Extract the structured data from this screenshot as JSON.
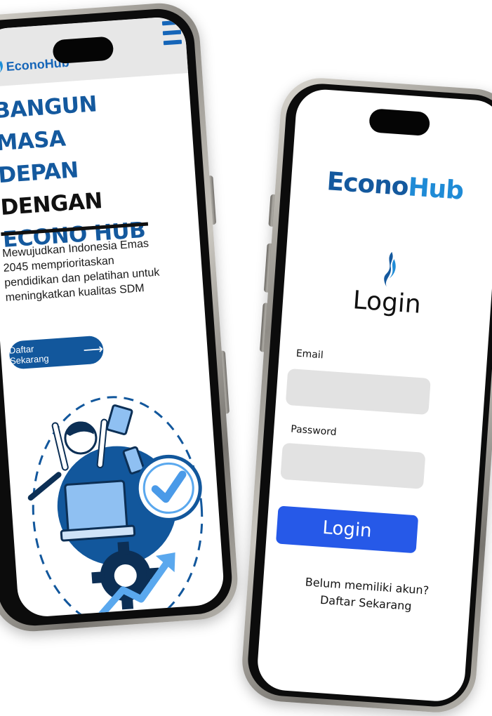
{
  "landing": {
    "logo_text": "EconoHub",
    "hero_line1": "BANGUN MASA",
    "hero_line2": "DEPAN",
    "hero_line3": "DENGAN",
    "hero_line4": "ECONO HUB",
    "description": "Mewujudkan Indonesia Emas 2045 memprioritaskan pendidikan dan pelatihan untuk meningkatkan kualitas SDM",
    "cta_label": "Daftar Sekarang"
  },
  "login": {
    "logo_part1": "Econo",
    "logo_part2": "Hub",
    "title": "Login",
    "email_label": "Email",
    "password_label": "Password",
    "button_label": "Login",
    "signup_prompt": "Belum memiliki akun?",
    "signup_link": "Daftar Sekarang"
  },
  "colors": {
    "primary": "#14599e",
    "accent": "#1f8bd6",
    "button": "#2659e8",
    "field": "#e2e2e2"
  },
  "icons": [
    "econohub-flame-icon",
    "menu-icon",
    "arrow-right-icon",
    "checkmark-icon",
    "gear-icon",
    "pen-icon"
  ]
}
